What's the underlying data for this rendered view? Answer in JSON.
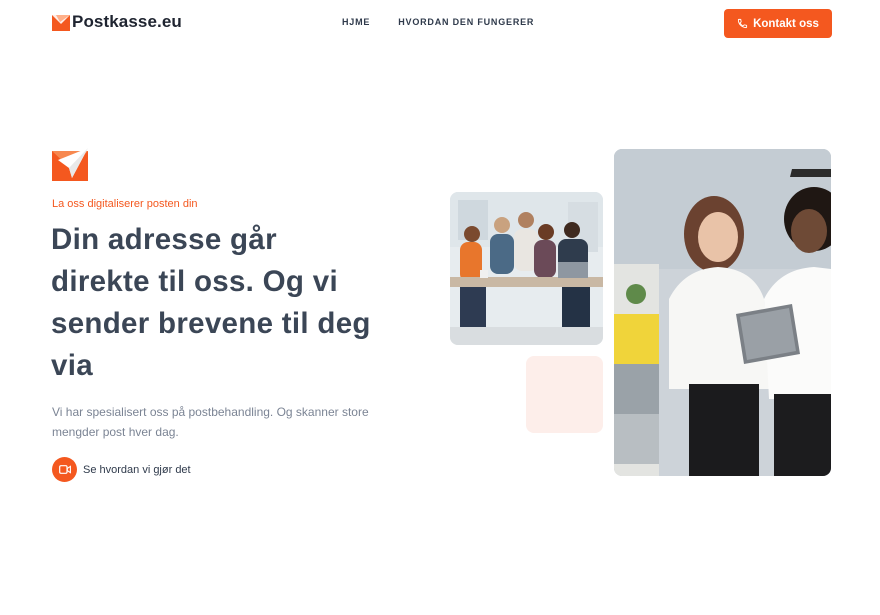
{
  "header": {
    "brand": "Postkasse.eu",
    "nav": [
      {
        "label": "HJME"
      },
      {
        "label": "HVORDAN DEN FUNGERER"
      }
    ],
    "cta_label": "Kontakt oss",
    "cta_icon": "phone-icon"
  },
  "hero": {
    "eyebrow": "La oss digitaliserer posten din",
    "headline": "Din adresse går direkte til oss. Og vi sender brevene til deg via",
    "subtext": "Vi har spesialisert oss på postbehandling. Og skanner store mengder post hver dag.",
    "video_label": "Se hvordan vi gjør det",
    "video_icon": "video-camera-icon"
  },
  "colors": {
    "accent": "#f4581f",
    "heading": "#3b4656",
    "body_text": "#7b8494",
    "decor_pink": "#fdeeea"
  }
}
